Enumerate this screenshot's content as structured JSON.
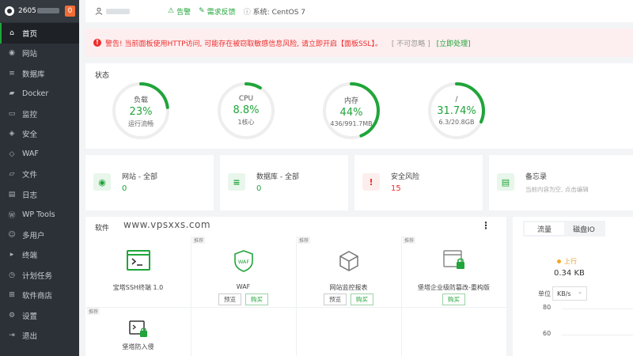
{
  "sidebar": {
    "hostname": "2605",
    "badge": "0",
    "items": [
      {
        "label": "首页",
        "icon": "home-icon",
        "glyph": "⌂"
      },
      {
        "label": "网站",
        "icon": "globe-icon",
        "glyph": "◉"
      },
      {
        "label": "数据库",
        "icon": "database-icon",
        "glyph": "≡"
      },
      {
        "label": "Docker",
        "icon": "docker-icon",
        "glyph": "▰"
      },
      {
        "label": "监控",
        "icon": "monitor-icon",
        "glyph": "▭"
      },
      {
        "label": "安全",
        "icon": "shield-icon",
        "glyph": "◈"
      },
      {
        "label": "WAF",
        "icon": "waf-icon",
        "glyph": "◇"
      },
      {
        "label": "文件",
        "icon": "folder-icon",
        "glyph": "▱"
      },
      {
        "label": "日志",
        "icon": "log-icon",
        "glyph": "▤"
      },
      {
        "label": "WP Tools",
        "icon": "wordpress-icon",
        "glyph": "Ⓦ"
      },
      {
        "label": "多用户",
        "icon": "users-icon",
        "glyph": "☺"
      },
      {
        "label": "终端",
        "icon": "terminal-icon",
        "glyph": "▸"
      },
      {
        "label": "计划任务",
        "icon": "clock-icon",
        "glyph": "◷"
      },
      {
        "label": "软件商店",
        "icon": "store-icon",
        "glyph": "⊞"
      },
      {
        "label": "设置",
        "icon": "gear-icon",
        "glyph": "⚙"
      },
      {
        "label": "退出",
        "icon": "logout-icon",
        "glyph": "⇥"
      }
    ]
  },
  "topbar": {
    "alarm": "告警",
    "feedback": "需求反馈",
    "system": "系统: CentOS 7"
  },
  "alert": {
    "message": "警告! 当前面板使用HTTP访问, 可能存在被窃取敏感信息风险, 请立即开启【面板SSL】。",
    "ignore": "[ 不可忽略 ]",
    "fix": "[立即处理]"
  },
  "status": {
    "title": "状态",
    "gauges": [
      {
        "label": "负载",
        "value": "23%",
        "sub": "运行流畅",
        "percent": 23
      },
      {
        "label": "CPU",
        "value": "8.8%",
        "sub": "1核心",
        "percent": 8.8
      },
      {
        "label": "内存",
        "value": "44%",
        "sub": "436/991.7MB",
        "percent": 44
      },
      {
        "label": "/",
        "value": "31.74%",
        "sub": "6.3/20.8GB",
        "percent": 31.74
      }
    ]
  },
  "cards": [
    {
      "title": "网站 - 全部",
      "value": "0",
      "icon": "globe-icon"
    },
    {
      "title": "数据库 - 全部",
      "value": "0",
      "icon": "database-icon"
    },
    {
      "title": "安全风险",
      "value": "15",
      "icon": "shield-alert-icon"
    },
    {
      "title": "备忘录",
      "sub": "当前内容为空, 点击编辑",
      "icon": "memo-icon"
    }
  ],
  "software": {
    "title": "软件",
    "watermark": "www.vpsxxs.com",
    "tiles": [
      {
        "name": "宝塔SSH终端 1.0",
        "tag": ""
      },
      {
        "name": "WAF",
        "tag": "推荐",
        "btn1": "预览",
        "btn2": "购买"
      },
      {
        "name": "网站监控报表",
        "tag": "推荐",
        "btn1": "预览",
        "btn2": "购买"
      },
      {
        "name": "堡塔企业级防篡改-重构版",
        "tag": "推荐",
        "btn2": "购买"
      },
      {
        "name": "堡塔防入侵",
        "tag": "推荐"
      }
    ]
  },
  "traffic": {
    "tab_traffic": "流量",
    "tab_disk": "磁盘IO",
    "up_label": "上行",
    "up_value": "0.34 KB",
    "unit_label": "单位",
    "unit": "KB/s",
    "ticks": [
      "80",
      "60"
    ]
  },
  "colors": {
    "accent": "#20a53a",
    "danger": "#ef2d2d",
    "sidebar": "#2c3138"
  }
}
